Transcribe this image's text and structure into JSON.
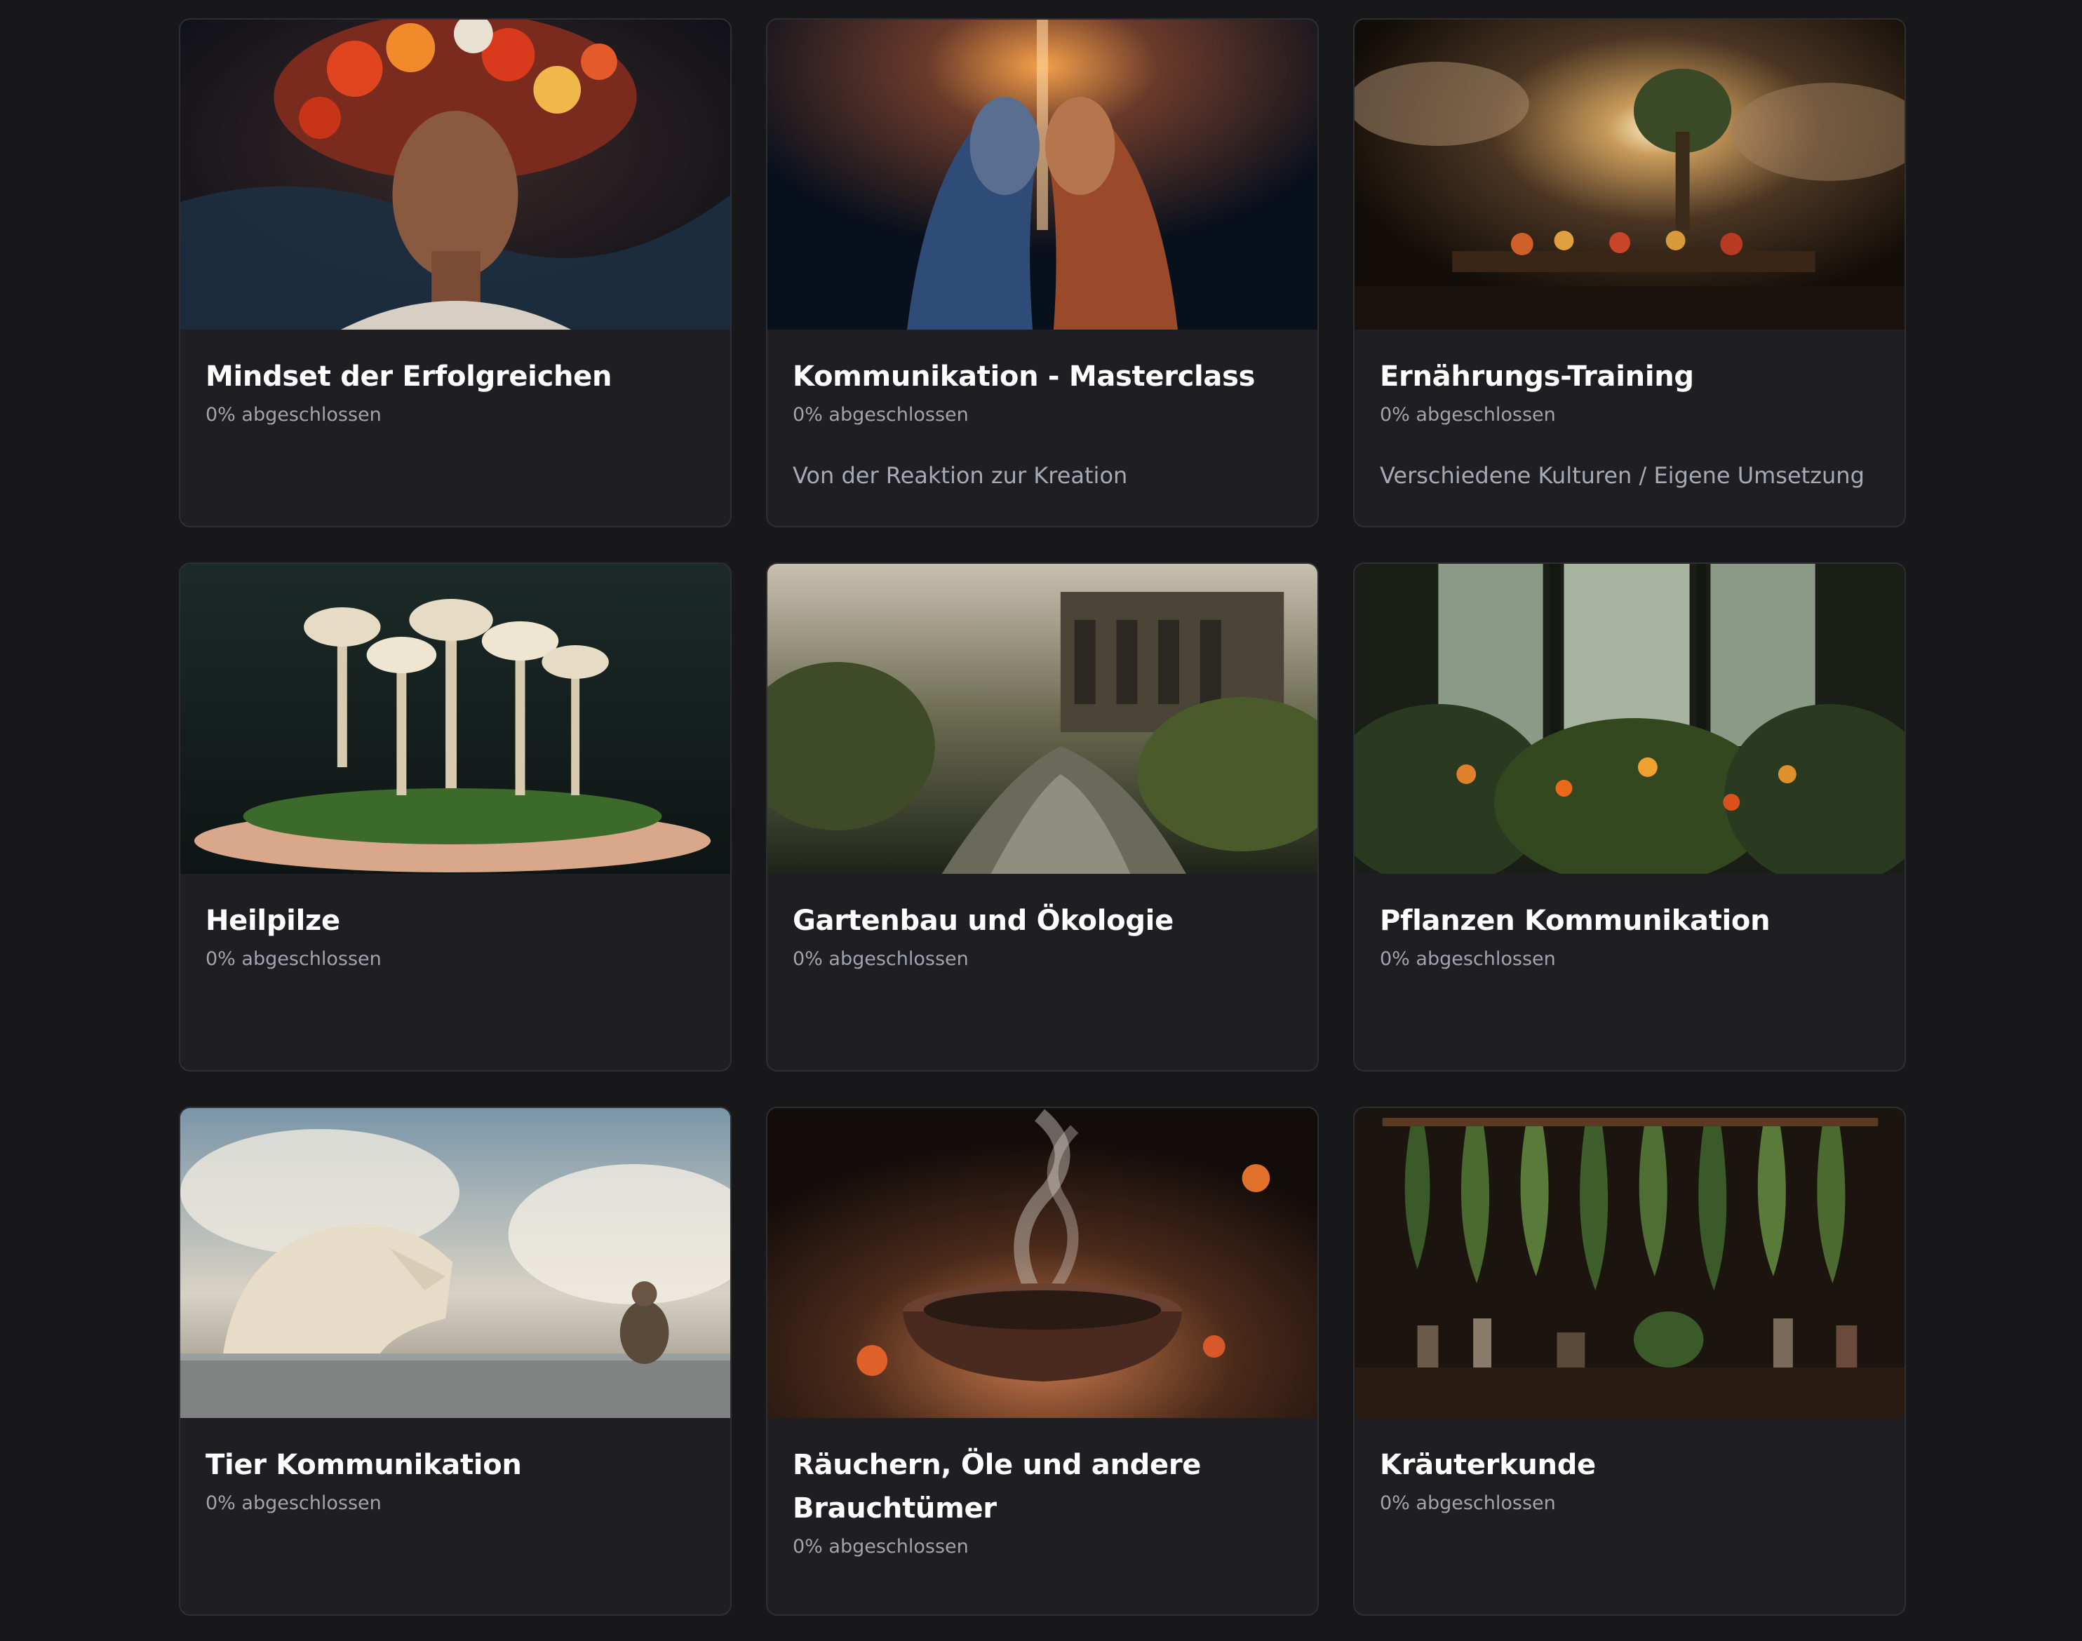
{
  "courses": [
    {
      "title": "Mindset der Erfolgreichen",
      "progress": "0% abgeschlossen",
      "description": "",
      "image_icon": "woman-flowers-image"
    },
    {
      "title": "Kommunikation - Masterclass",
      "progress": "0% abgeschlossen",
      "description": "Von der Reaktion zur Kreation",
      "image_icon": "two-faces-image"
    },
    {
      "title": "Ernährungs-Training",
      "progress": "0% abgeschlossen",
      "description": "Verschiedene Kulturen / Eigene Umsetzung",
      "image_icon": "food-table-image"
    },
    {
      "title": "Heilpilze",
      "progress": "0% abgeschlossen",
      "description": "",
      "image_icon": "mushrooms-image"
    },
    {
      "title": "Gartenbau und Ökologie",
      "progress": "0% abgeschlossen",
      "description": "",
      "image_icon": "garden-pond-image"
    },
    {
      "title": "Pflanzen Kommunikation",
      "progress": "0% abgeschlossen",
      "description": "",
      "image_icon": "greenhouse-plants-image"
    },
    {
      "title": "Tier Kommunikation",
      "progress": "0% abgeschlossen",
      "description": "",
      "image_icon": "wolf-man-image"
    },
    {
      "title": "Räuchern, Öle und andere Brauchtümer",
      "progress": "0% abgeschlossen",
      "description": "",
      "image_icon": "incense-bowl-image"
    },
    {
      "title": "Kräuterkunde",
      "progress": "0% abgeschlossen",
      "description": "",
      "image_icon": "hanging-herbs-image"
    }
  ],
  "colors": {
    "background": "#18181b",
    "card": "#1e1e23",
    "card_border": "#2e2e35",
    "title": "#ffffff",
    "muted": "#a3a3ab"
  }
}
